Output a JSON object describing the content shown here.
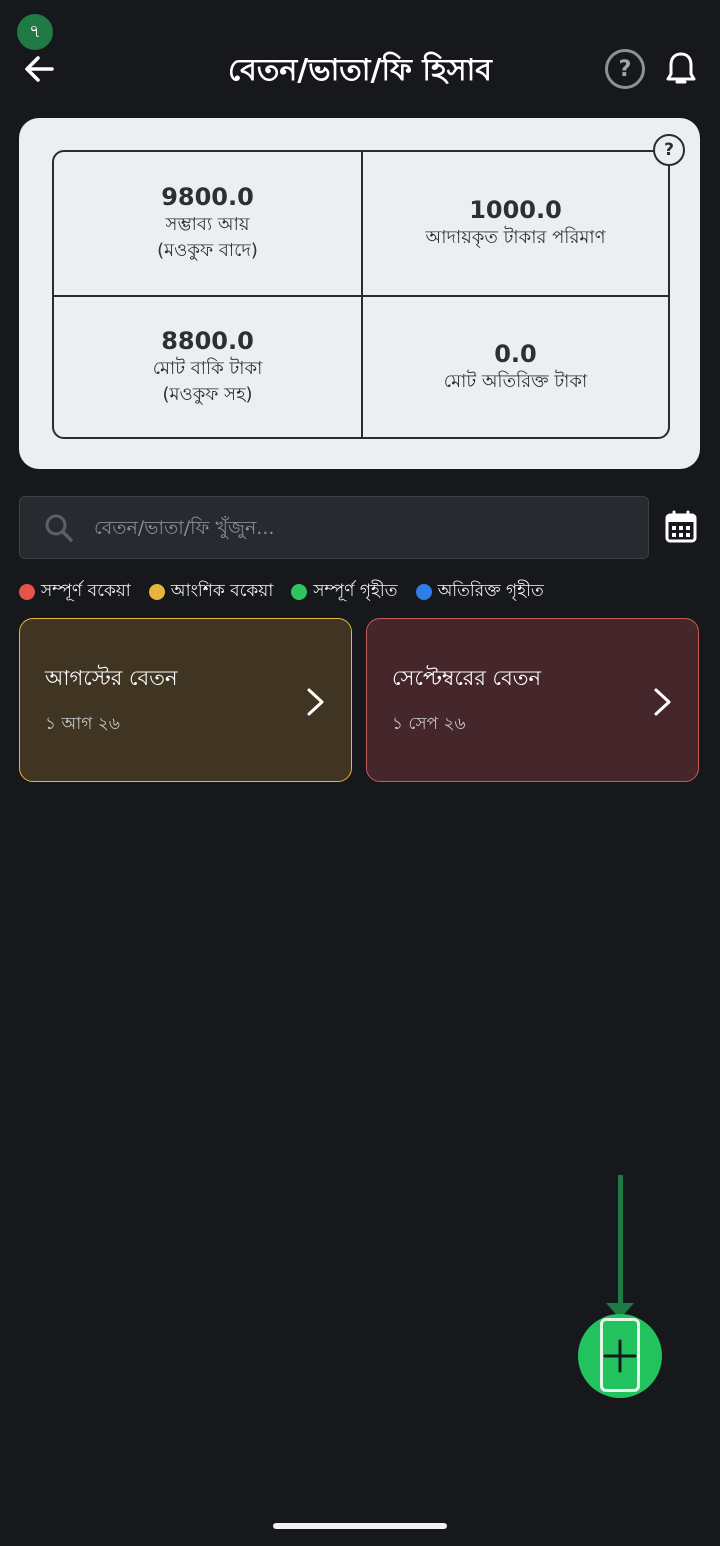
{
  "step_badge": "৭",
  "header": {
    "title": "বেতন/ভাতা/ফি হিসাব",
    "help_icon": "?"
  },
  "summary": {
    "help_icon": "?",
    "cells": [
      {
        "value": "9800.0",
        "label_line1": "সম্ভাব্য আয়",
        "label_line2": "(মওকুফ বাদে)"
      },
      {
        "value": "1000.0",
        "label_line1": "আদায়কৃত টাকার পরিমাণ",
        "label_line2": ""
      },
      {
        "value": "8800.0",
        "label_line1": "মোট বাকি টাকা",
        "label_line2": "(মওকুফ সহ)"
      },
      {
        "value": "0.0",
        "label_line1": "মোট অতিরিক্ত টাকা",
        "label_line2": ""
      }
    ]
  },
  "search": {
    "placeholder": "বেতন/ভাতা/ফি খুঁজুন..."
  },
  "legend": [
    {
      "label": "সম্পূর্ণ বকেয়া",
      "color": "#e5534b"
    },
    {
      "label": "আংশিক বকেয়া",
      "color": "#e7b43c"
    },
    {
      "label": "সম্পূর্ণ গৃহীত",
      "color": "#2fc45f"
    },
    {
      "label": "অতিরিক্ত গৃহীত",
      "color": "#2f7fe8"
    }
  ],
  "fees": [
    {
      "name": "আগস্টের বেতন",
      "date": "১ আগ ২৬",
      "status": "আংশিক বকেয়া"
    },
    {
      "name": "সেপ্টেম্বরের বেতন",
      "date": "১ সেপ ২৬",
      "status": "সম্পূর্ণ বকেয়া"
    }
  ],
  "icons": {
    "back": "arrow-left-icon",
    "bell": "bell-icon",
    "search": "search-icon",
    "calendar": "calendar-icon",
    "chevron": "chevron-right-icon",
    "add": "plus-icon"
  },
  "colors": {
    "background": "#16181b",
    "card": "#eceef0",
    "fab": "#22c35e",
    "annotation": "#1f7a45"
  }
}
